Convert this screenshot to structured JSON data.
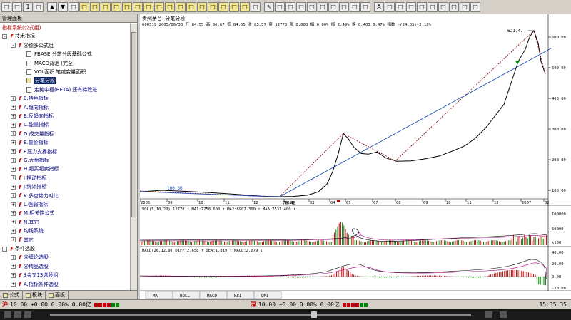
{
  "toolbar": {
    "buttons": [
      "□",
      "□",
      "1",
      "□",
      "▲",
      "▼",
      "□",
      "□",
      "□",
      "□",
      "□",
      "□",
      "□",
      "□",
      "□",
      "□",
      "□",
      "□",
      "□",
      "□",
      "□",
      "□",
      "□",
      "□",
      "↖",
      "□",
      "□",
      "□",
      "□",
      "□",
      "□",
      "□",
      "□",
      "□",
      "A",
      "□",
      "□",
      "□",
      "□",
      "□",
      "□",
      "□",
      "□",
      "□"
    ]
  },
  "left_panel": {
    "title": "管理面板",
    "tree": [
      {
        "label": "指标系统(公式组)",
        "level": 0,
        "expander": "",
        "icon": "none",
        "color": "red"
      },
      {
        "label": "技术指标",
        "level": 0,
        "expander": "-",
        "icon": "folder",
        "color": "black"
      },
      {
        "label": "@德多公式组",
        "level": 1,
        "expander": "-",
        "icon": "folder",
        "color": "black"
      },
      {
        "label": "FBASE 分笔分段基础公式",
        "level": 2,
        "expander": "",
        "icon": "doc",
        "color": "black"
      },
      {
        "label": "MACD背驰 (完全)",
        "level": 2,
        "expander": "",
        "icon": "doc",
        "color": "black"
      },
      {
        "label": "VOL面积 笔或变量面积",
        "level": 2,
        "expander": "",
        "icon": "doc",
        "color": "black"
      },
      {
        "label": "分笔分段",
        "level": 2,
        "expander": "",
        "icon": "doc",
        "color": "selected"
      },
      {
        "label": "走势中枢(BETA) 还有待改进",
        "level": 2,
        "expander": "",
        "icon": "doc",
        "color": "blue"
      },
      {
        "label": "0.特色指标",
        "level": 1,
        "expander": "+",
        "icon": "folder",
        "color": "blue"
      },
      {
        "label": "A.趋向指标",
        "level": 1,
        "expander": "+",
        "icon": "folder",
        "color": "blue"
      },
      {
        "label": "B.反趋向指标",
        "level": 1,
        "expander": "+",
        "icon": "folder",
        "color": "blue"
      },
      {
        "label": "C.能量指标",
        "level": 1,
        "expander": "+",
        "icon": "folder",
        "color": "blue"
      },
      {
        "label": "D.成交量指标",
        "level": 1,
        "expander": "+",
        "icon": "folder",
        "color": "blue"
      },
      {
        "label": "E.量价指标",
        "level": 1,
        "expander": "+",
        "icon": "folder",
        "color": "blue"
      },
      {
        "label": "F.压力支撑指标",
        "level": 1,
        "expander": "+",
        "icon": "folder",
        "color": "blue"
      },
      {
        "label": "G.大盘指标",
        "level": 1,
        "expander": "+",
        "icon": "folder",
        "color": "blue"
      },
      {
        "label": "H.超买超卖指标",
        "level": 1,
        "expander": "+",
        "icon": "folder",
        "color": "blue"
      },
      {
        "label": "I.摆动指标",
        "level": 1,
        "expander": "+",
        "icon": "folder",
        "color": "blue"
      },
      {
        "label": "J.统计指标",
        "level": 1,
        "expander": "+",
        "icon": "folder",
        "color": "blue"
      },
      {
        "label": "K.多空势力对比",
        "level": 1,
        "expander": "+",
        "icon": "folder",
        "color": "blue"
      },
      {
        "label": "L.强弱指标",
        "level": 1,
        "expander": "+",
        "icon": "folder",
        "color": "blue"
      },
      {
        "label": "M.相关性公式",
        "level": 1,
        "expander": "+",
        "icon": "folder",
        "color": "blue"
      },
      {
        "label": "N.其它",
        "level": 1,
        "expander": "+",
        "icon": "folder",
        "color": "blue"
      },
      {
        "label": "均线系统",
        "level": 1,
        "expander": "+",
        "icon": "folder",
        "color": "blue"
      },
      {
        "label": "其它",
        "level": 1,
        "expander": "+",
        "icon": "folder",
        "color": "blue"
      },
      {
        "label": "条件选股",
        "level": 0,
        "expander": "-",
        "icon": "folder",
        "color": "black"
      },
      {
        "label": "@缠论选股",
        "level": 1,
        "expander": "+",
        "icon": "folder",
        "color": "blue"
      },
      {
        "label": "@精品选股",
        "level": 1,
        "expander": "+",
        "icon": "folder",
        "color": "blue"
      },
      {
        "label": "$金叉13选股组",
        "level": 1,
        "expander": "+",
        "icon": "folder",
        "color": "blue"
      },
      {
        "label": "A.指标条件选股",
        "level": 1,
        "expander": "+",
        "icon": "folder",
        "color": "blue"
      }
    ],
    "tabs": [
      "公式",
      "板块",
      "面板"
    ]
  },
  "chart": {
    "title": "贵州茅台 分笔分段",
    "info_line": "600519 2005/06/30 开 84.55 高 86.67 低 84.55 收 85.57 量 12778 涨 0.000 幅 0.00% 振 2.49% 换 0.403 0.47% 指数 -(24.05)-2.18%",
    "max_label": "621.47",
    "min_label": "78.42",
    "left_label": "100.56",
    "price_axis": [
      "600.00",
      "500.00",
      "400.00",
      "300.00",
      "200.00",
      "100.00"
    ],
    "time_axis": [
      "2005",
      "09",
      "10",
      "11",
      "12",
      "2006",
      "03",
      "04",
      "05",
      "07",
      "08",
      "09",
      "10",
      "11",
      "12",
      "2007",
      "02"
    ],
    "vol_label": "VOL(5,10,20) 12778 ↑ MA1:7758.600 ↑ MA2:6907.300 ↑ MA3:7531.400 ↑",
    "vol_axis": [
      "100000",
      "50000",
      "x100"
    ],
    "macd_label": "MACD(26,12,9) DIFF:2.658 ↑ DEA:1.819 ↑ MACD:2.079 ↓",
    "macd_axis": [
      "40.00",
      "20.00",
      "0.00",
      "-20.00"
    ],
    "tabs": [
      "MA",
      "BOLL",
      "MACD",
      "RSI",
      "DMI"
    ]
  },
  "status": {
    "sh_label": "沪",
    "sh_value": "10.00 +0.00 0.00% 0.00亿",
    "sz_label": "深",
    "sz_value": "10.00 +0.00 0.00% 0.00亿",
    "clock": "15:35:35"
  },
  "colors": {
    "price_line": "#000000",
    "trend_line": "#1f4fb5",
    "dotted_red": "#8b0000",
    "up": "#c00000",
    "down": "#008000",
    "ma_magenta": "#a0007a"
  }
}
